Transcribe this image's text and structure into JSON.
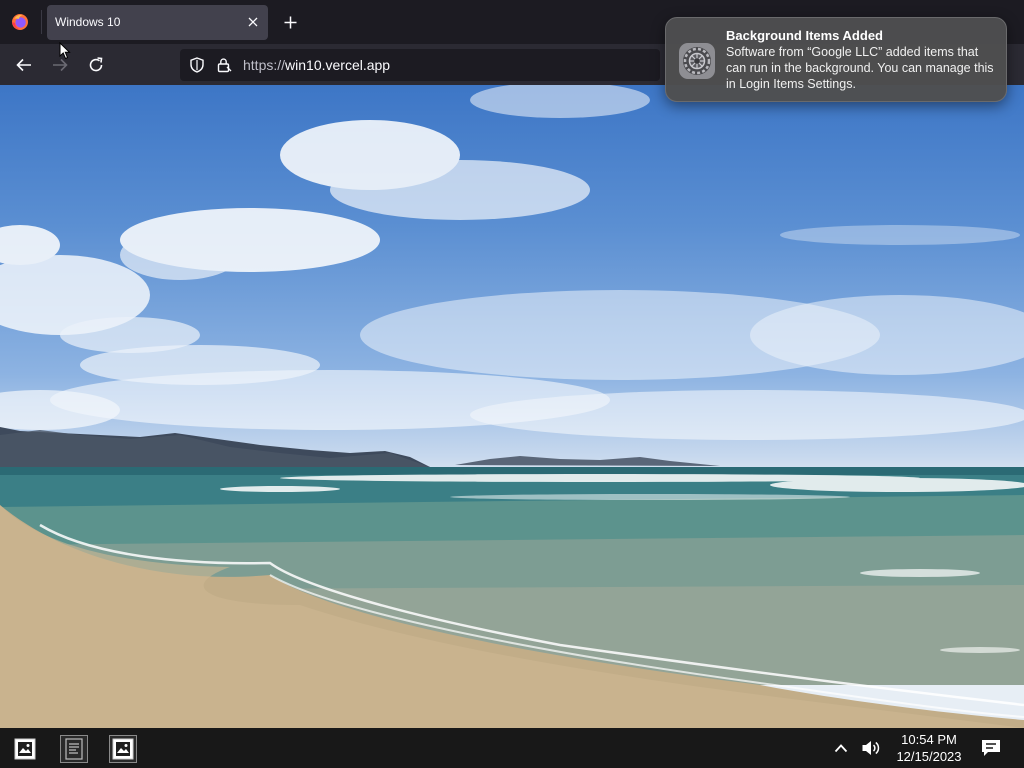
{
  "browser": {
    "tab": {
      "title": "Windows 10"
    },
    "url": {
      "scheme": "https://",
      "host": "win10.vercel.app"
    },
    "icons": [
      "firefox-icon",
      "close-icon",
      "plus-icon",
      "back-arrow-icon",
      "forward-arrow-icon",
      "reload-icon",
      "shield-icon",
      "lock-icon"
    ]
  },
  "notification": {
    "title": "Background Items Added",
    "body": "Software from “Google LLC” added items that can run in the background. You can manage this in Login Items Settings.",
    "icon": "gear-icon"
  },
  "desktop": {
    "wallpaper": "beach-landscape"
  },
  "taskbar": {
    "apps": [
      {
        "name": "image-app",
        "active": false
      },
      {
        "name": "document-app",
        "active": true
      },
      {
        "name": "image-app",
        "active": true
      }
    ],
    "tray": {
      "icons": [
        "chevron-up-icon",
        "volume-icon",
        "notification-center-icon"
      ]
    },
    "clock": {
      "time": "10:54 PM",
      "date": "12/15/2023"
    }
  },
  "colors": {
    "chrome_bg": "#1c1b22",
    "toolbar_bg": "#2b2a33",
    "tab_active": "#42414d",
    "taskbar_bg": "#181818",
    "toast_bg": "#4e4e50"
  }
}
